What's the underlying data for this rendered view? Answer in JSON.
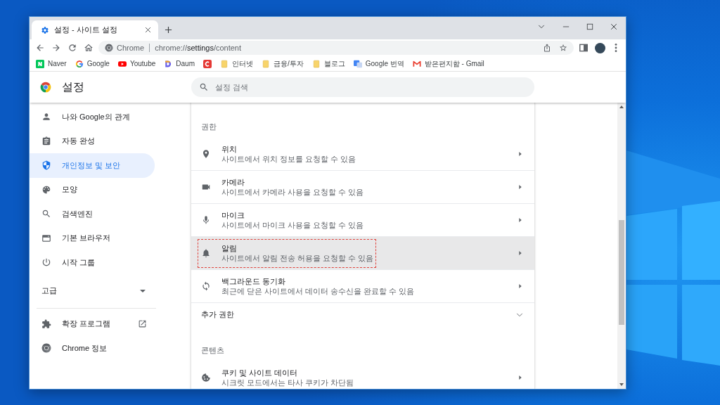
{
  "window": {
    "tabs": [
      {
        "title": "설정 - 사이트 설정",
        "selected": true
      }
    ]
  },
  "toolbar": {
    "omnibox": {
      "chip": "Chrome",
      "url": "chrome://**settings**/content"
    }
  },
  "bookmarks": [
    {
      "label": "Naver",
      "kind": "site"
    },
    {
      "label": "Google",
      "kind": "site"
    },
    {
      "label": "Youtube",
      "kind": "site"
    },
    {
      "label": "Daum",
      "kind": "site"
    },
    {
      "kind": "site"
    },
    {
      "label": "인터넷",
      "kind": "folder"
    },
    {
      "label": "금융/투자",
      "kind": "folder"
    },
    {
      "label": "블로그",
      "kind": "folder"
    },
    {
      "label": "Google 번역",
      "kind": "site"
    },
    {
      "label": "받은편지함 - Gmail",
      "kind": "site"
    }
  ],
  "settings_header": {
    "title": "설정",
    "search": {
      "placeholder": "설정 검색"
    }
  },
  "sidebar": {
    "items": [
      {
        "label": "나와 Google의 관계",
        "selected": false
      },
      {
        "label": "자동 완성",
        "selected": false
      },
      {
        "label": "개인정보 및 보안",
        "selected": true
      },
      {
        "label": "모양",
        "selected": false
      },
      {
        "label": "검색엔진",
        "selected": false
      },
      {
        "label": "기본 브라우저",
        "selected": false
      },
      {
        "label": "시작 그룹",
        "selected": false
      }
    ],
    "advanced": {
      "label": "고급",
      "expanded": false
    },
    "links": [
      {
        "label": "확장 프로그램",
        "external": true
      },
      {
        "label": "Chrome 정보",
        "external": false
      }
    ]
  },
  "content": {
    "sections": [
      {
        "heading": "권한",
        "rows": [
          {
            "title": "위치",
            "description": "사이트에서 위치 정보를 요청할 수 있음",
            "hovered": false,
            "annotated": false
          },
          {
            "title": "카메라",
            "description": "사이트에서 카메라 사용을 요청할 수 있음",
            "hovered": false,
            "annotated": false
          },
          {
            "title": "마이크",
            "description": "사이트에서 마이크 사용을 요청할 수 있음",
            "hovered": false,
            "annotated": false
          },
          {
            "title": "알림",
            "description": "사이트에서 알림 전송 허용을 요청할 수 있음",
            "hovered": true,
            "annotated": true
          },
          {
            "title": "백그라운드 동기화",
            "description": "최근에 닫은 사이트에서 데이터 송수신을 완료할 수 있음",
            "hovered": false,
            "annotated": false
          }
        ],
        "more": {
          "label": "추가 권한",
          "expanded": false
        }
      },
      {
        "heading": "콘텐츠",
        "rows": [
          {
            "title": "쿠키 및 사이트 데이터",
            "description": "시크릿 모드에서는 타사 쿠키가 차단됨",
            "hovered": false,
            "annotated": false
          }
        ]
      }
    ]
  }
}
